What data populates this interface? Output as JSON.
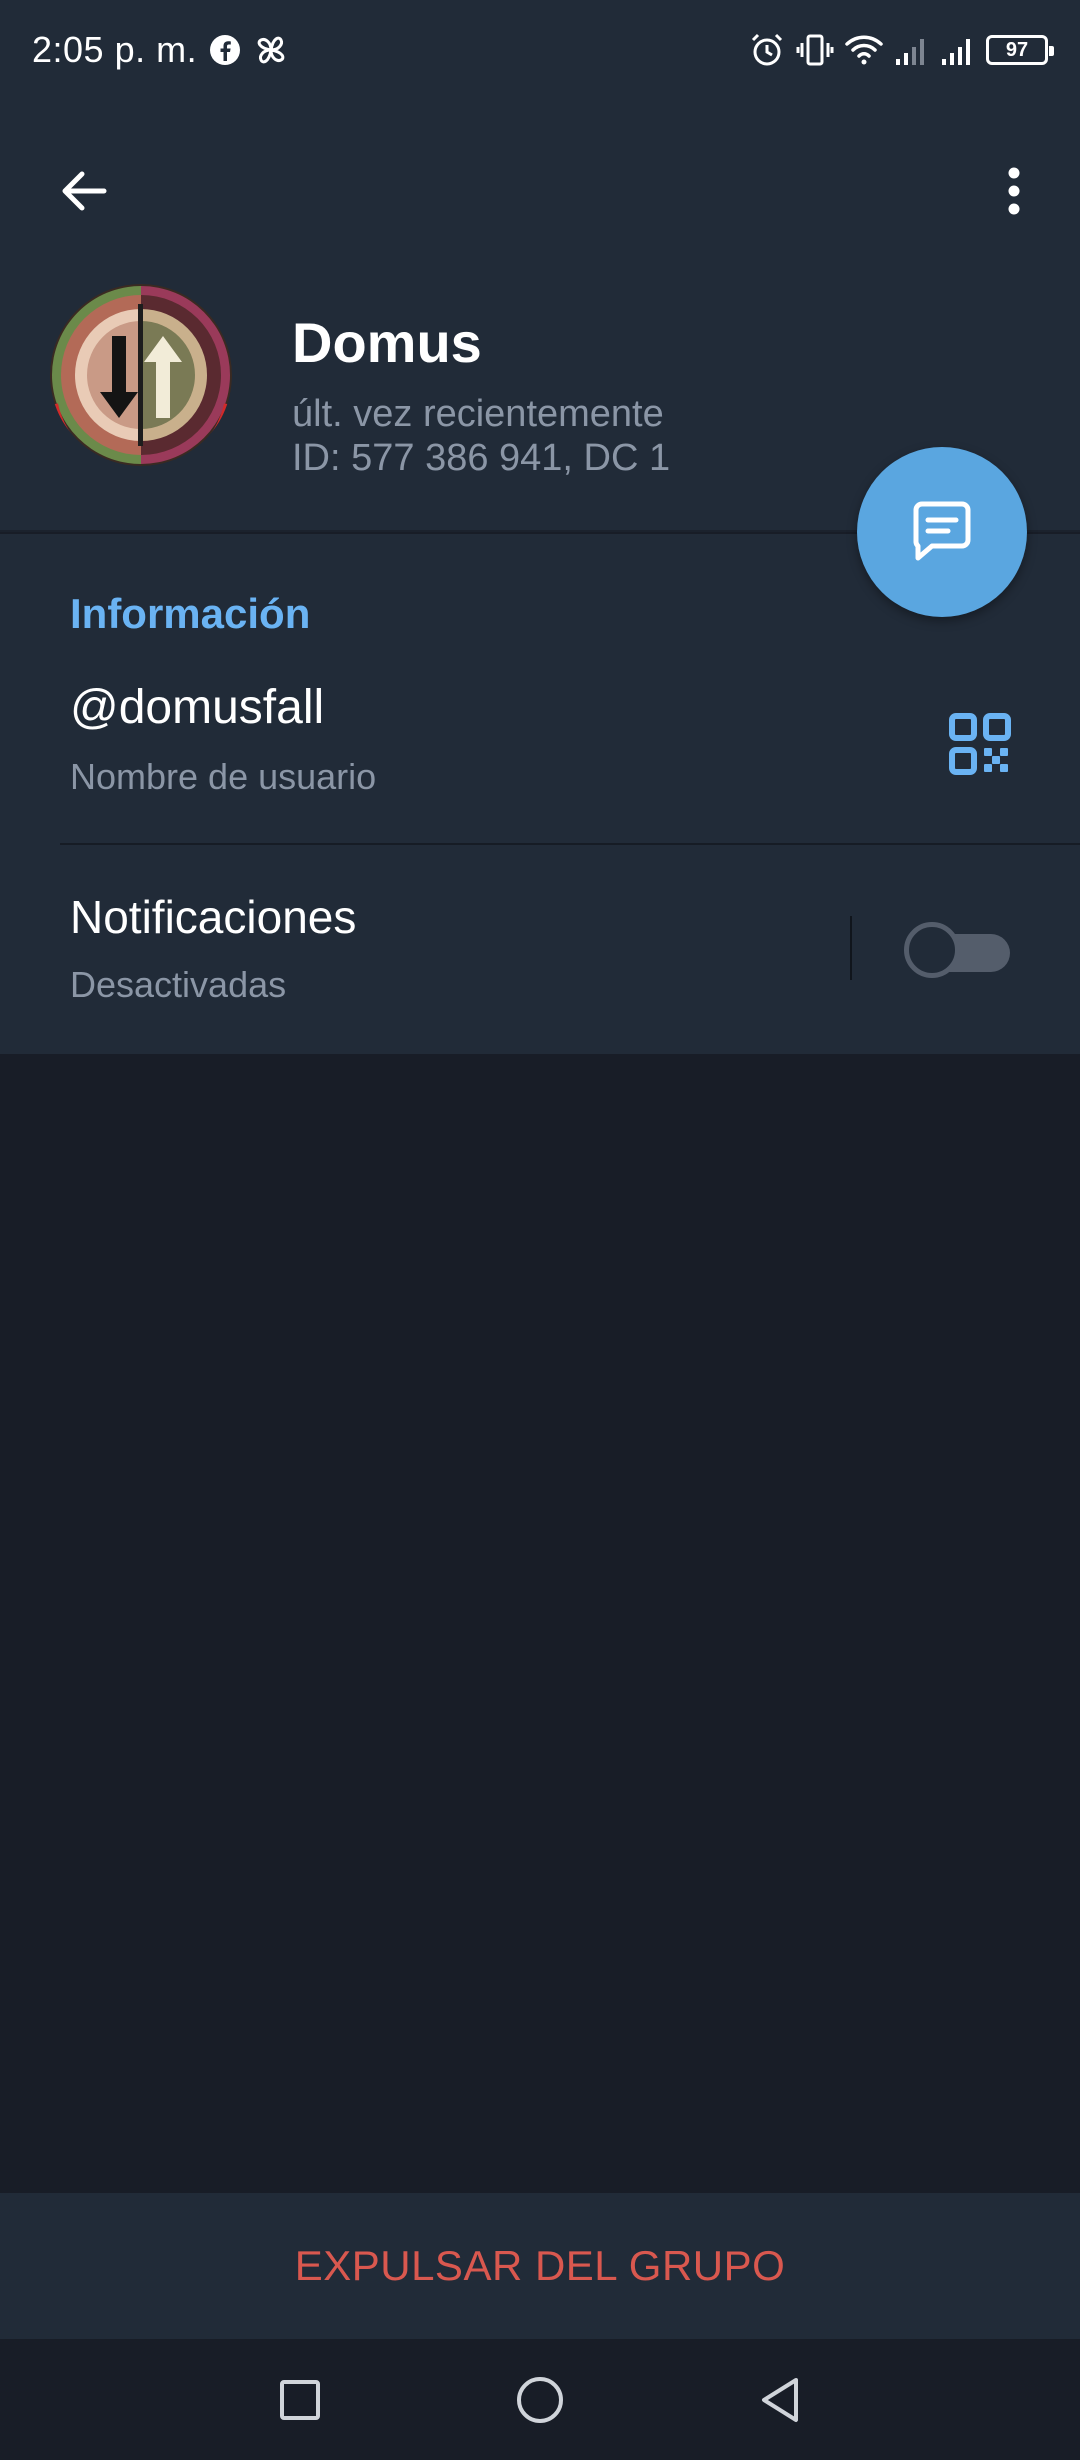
{
  "status_bar": {
    "time": "2:05 p. m.",
    "battery": "97",
    "icons": [
      "facebook-icon",
      "pinwheel-icon",
      "alarm-icon",
      "vibrate-icon",
      "wifi-icon",
      "signal-icon",
      "signal-icon",
      "battery-icon"
    ]
  },
  "header": {
    "back_icon": "arrow-left-icon",
    "menu_icon": "more-vertical-icon"
  },
  "profile": {
    "name": "Domus",
    "status": "últ. vez recientemente",
    "id_line": "ID: 577 386 941, DC 1"
  },
  "fab": {
    "icon": "message-icon"
  },
  "info": {
    "section_title": "Información",
    "username": "@domusfall",
    "username_label": "Nombre de usuario",
    "qr_icon": "qr-code-icon",
    "notifications_title": "Notificaciones",
    "notifications_status": "Desactivadas",
    "notifications_enabled": false
  },
  "bottom_action": {
    "label": "EXPULSAR DEL GRUPO"
  },
  "nav_bar": {
    "icons": [
      "square-icon",
      "circle-icon",
      "triangle-back-icon"
    ]
  },
  "colors": {
    "background": "#181d27",
    "surface": "#212b38",
    "accent": "#6ab3f3",
    "fab": "#5aa6e0",
    "secondary_text": "#8b96a6",
    "destructive": "#d9584f"
  }
}
